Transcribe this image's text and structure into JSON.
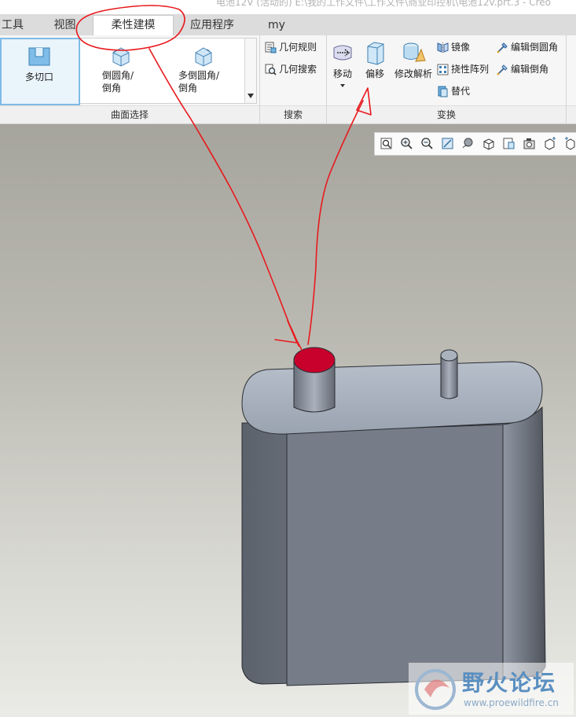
{
  "window": {
    "title": "电池12V (活动的) E:\\我的工作文件\\工作文件\\商业印控机\\电池12v.prt.3 - Creo"
  },
  "tabs": [
    "工具",
    "视图",
    "柔性建模",
    "应用程序",
    "my"
  ],
  "active_tab": "柔性建模",
  "ribbon": {
    "surface_group": {
      "label": "曲面选择",
      "buttons": {
        "multi_cut": "多切口",
        "round_chamfer": "倒圆角/\n倒角",
        "multi_round": "多倒圆角/\n倒角"
      }
    },
    "search_group": {
      "label": "搜索",
      "geometry_rules": "几何规则",
      "geometry_search": "几何搜索"
    },
    "transform_group": {
      "label": "变换",
      "move": "移动",
      "offset": "偏移",
      "modify_analytic": "修改解析",
      "mirror": "镜像",
      "flex_pattern": "挠性阵列",
      "replace": "替代",
      "edit_round": "编辑倒圆角",
      "edit_chamfer": "编辑倒角"
    }
  },
  "annotation": {
    "color": "#e8191d"
  },
  "watermark": {
    "text": "野火论坛",
    "url": "www.proewildfire.cn"
  },
  "colors": {
    "highlight_face": "#c8002c",
    "model": "#7a818c",
    "model_light": "#a6adb9"
  }
}
